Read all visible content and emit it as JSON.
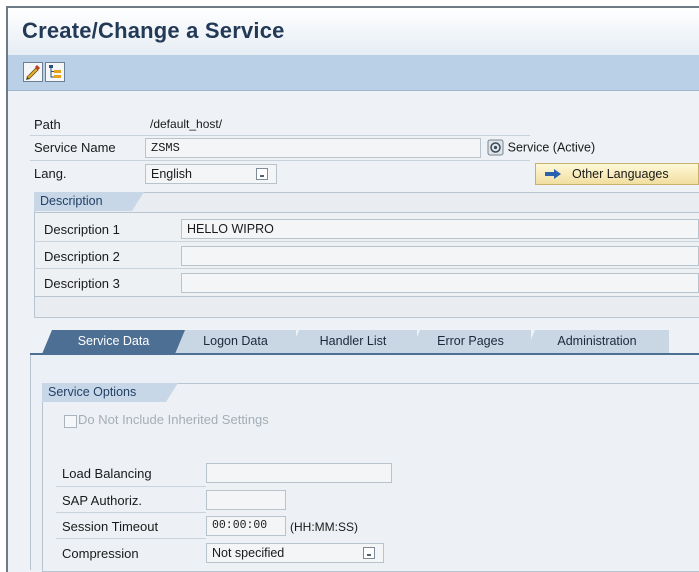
{
  "window": {
    "title": "Create/Change a Service"
  },
  "toolbar": {
    "buttons": [
      "edit-icon",
      "hierarchy-icon"
    ]
  },
  "header": {
    "path_label": "Path",
    "path_value": "/default_host/",
    "service_name_label": "Service Name",
    "service_name_value": "ZSMS",
    "service_status": "Service (Active)",
    "lang_label": "Lang.",
    "lang_value": "English",
    "other_languages_label": "Other Languages"
  },
  "description": {
    "group_title": "Description",
    "rows": [
      {
        "label": "Description 1",
        "value": "HELLO WIPRO"
      },
      {
        "label": "Description 2",
        "value": ""
      },
      {
        "label": "Description 3",
        "value": ""
      }
    ]
  },
  "tabs": [
    {
      "label": "Service Data",
      "active": true
    },
    {
      "label": "Logon Data",
      "active": false
    },
    {
      "label": "Handler List",
      "active": false
    },
    {
      "label": "Error Pages",
      "active": false
    },
    {
      "label": "Administration",
      "active": false
    }
  ],
  "service_options": {
    "group_title": "Service Options",
    "inherit_checkbox_label": "Do Not Include Inherited Settings",
    "inherit_checked": false,
    "load_balancing_label": "Load Balancing",
    "load_balancing_value": "",
    "sap_authoriz_label": "SAP Authoriz.",
    "sap_authoriz_value": "",
    "session_timeout_label": "Session Timeout",
    "session_timeout_value": "00:00:00",
    "session_timeout_format": "(HH:MM:SS)",
    "compression_label": "Compression",
    "compression_value": "Not specified"
  },
  "colors": {
    "accent": "#4d6f94",
    "title": "#233a57",
    "toolbar": "#b9d0e6"
  }
}
